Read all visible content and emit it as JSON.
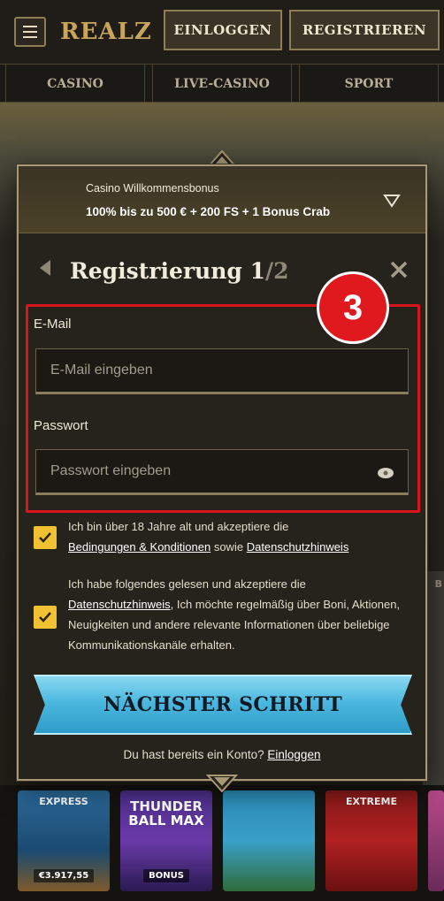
{
  "header": {
    "logo_text": "REALZ",
    "login_label": "EINLOGGEN",
    "register_label": "REGISTRIEREN"
  },
  "nav": {
    "tabs": [
      {
        "label": "CASINO"
      },
      {
        "label": "LIVE-CASINO"
      },
      {
        "label": "SPORT"
      }
    ]
  },
  "background": {
    "side_letter": "B",
    "games": [
      {
        "top": "EXPRESS",
        "tag": "€3.917,55"
      },
      {
        "top": "THUNDER BALL MAX",
        "tag": "BONUS"
      },
      {
        "top": "",
        "tag": ""
      },
      {
        "top": "EXTREME",
        "tag": ""
      }
    ]
  },
  "modal": {
    "bonus": {
      "line1": "Casino Willkommensbonus",
      "line2": "100% bis zu 500 € + 200 FS + 1 Bonus Crab"
    },
    "title_main": "Registrierung 1",
    "title_total": "/2",
    "step_badge": "3",
    "email": {
      "label": "E-Mail",
      "placeholder": "E-Mail eingeben",
      "value": ""
    },
    "password": {
      "label": "Passwort",
      "placeholder": "Passwort eingeben",
      "value": ""
    },
    "consent1": {
      "text_a": "Ich bin über 18 Jahre alt und akzeptiere die",
      "link_terms": "Bedingungen & Konditionen",
      "text_b": "sowie",
      "link_privacy": "Datenschutzhinweis",
      "checked": true
    },
    "consent2": {
      "text_a": "Ich habe folgendes gelesen und akzeptiere die",
      "link_privacy": "Datenschutzhinweis",
      "text_b": ", Ich möchte regelmäßig über Boni, Aktionen, Neuigkeiten und andere relevante Informationen über beliebige Kommunikationskanäle erhalten.",
      "checked": true
    },
    "next_label": "NÄCHSTER SCHRITT",
    "login_prompt": "Du hast bereits ein Konto?",
    "login_link": "Einloggen"
  },
  "colors": {
    "accent_gold": "#c8a55d",
    "checkbox_yellow": "#f0c233",
    "cta_blue": "#4cb8e0",
    "highlight_red": "#e0191f"
  }
}
